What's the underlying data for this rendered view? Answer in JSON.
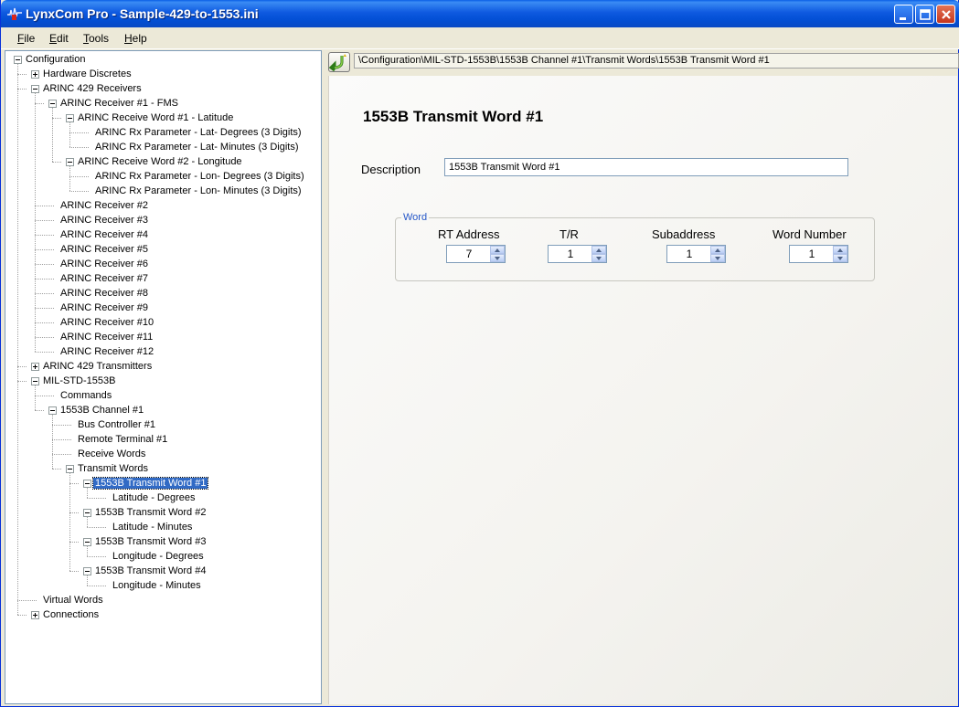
{
  "window": {
    "title": "LynxCom Pro - Sample-429-to-1553.ini",
    "icon": "lynxcom-app-icon"
  },
  "menu": [
    "File",
    "Edit",
    "Tools",
    "Help"
  ],
  "tree": [
    {
      "label": "Configuration",
      "level": 0,
      "exp": "minus"
    },
    {
      "label": "Hardware Discretes",
      "level": 1,
      "exp": "plus"
    },
    {
      "label": "ARINC 429 Receivers",
      "level": 1,
      "exp": "minus"
    },
    {
      "label": "ARINC Receiver #1 - FMS",
      "level": 2,
      "exp": "minus"
    },
    {
      "label": "ARINC Receive Word #1 - Latitude",
      "level": 3,
      "exp": "minus"
    },
    {
      "label": "ARINC Rx Parameter - Lat- Degrees (3 Digits)",
      "level": 4,
      "exp": ""
    },
    {
      "label": "ARINC Rx Parameter - Lat- Minutes (3 Digits)",
      "level": 4,
      "exp": ""
    },
    {
      "label": "ARINC Receive Word #2 - Longitude",
      "level": 3,
      "exp": "minus"
    },
    {
      "label": "ARINC Rx Parameter - Lon- Degrees (3 Digits)",
      "level": 4,
      "exp": ""
    },
    {
      "label": "ARINC Rx Parameter - Lon- Minutes (3 Digits)",
      "level": 4,
      "exp": ""
    },
    {
      "label": "ARINC Receiver #2",
      "level": 2,
      "exp": ""
    },
    {
      "label": "ARINC Receiver #3",
      "level": 2,
      "exp": ""
    },
    {
      "label": "ARINC Receiver #4",
      "level": 2,
      "exp": ""
    },
    {
      "label": "ARINC Receiver #5",
      "level": 2,
      "exp": ""
    },
    {
      "label": "ARINC Receiver #6",
      "level": 2,
      "exp": ""
    },
    {
      "label": "ARINC Receiver #7",
      "level": 2,
      "exp": ""
    },
    {
      "label": "ARINC Receiver #8",
      "level": 2,
      "exp": ""
    },
    {
      "label": "ARINC Receiver #9",
      "level": 2,
      "exp": ""
    },
    {
      "label": "ARINC Receiver #10",
      "level": 2,
      "exp": ""
    },
    {
      "label": "ARINC Receiver #11",
      "level": 2,
      "exp": ""
    },
    {
      "label": "ARINC Receiver #12",
      "level": 2,
      "exp": ""
    },
    {
      "label": "ARINC 429 Transmitters",
      "level": 1,
      "exp": "plus"
    },
    {
      "label": "MIL-STD-1553B",
      "level": 1,
      "exp": "minus"
    },
    {
      "label": "Commands",
      "level": 2,
      "exp": ""
    },
    {
      "label": "1553B Channel #1",
      "level": 2,
      "exp": "minus"
    },
    {
      "label": "Bus Controller #1",
      "level": 3,
      "exp": ""
    },
    {
      "label": "Remote Terminal #1",
      "level": 3,
      "exp": ""
    },
    {
      "label": "Receive Words",
      "level": 3,
      "exp": ""
    },
    {
      "label": "Transmit Words",
      "level": 3,
      "exp": "minus"
    },
    {
      "label": "1553B Transmit Word #1",
      "level": 4,
      "exp": "minus",
      "selected": true
    },
    {
      "label": "Latitude - Degrees",
      "level": 5,
      "exp": ""
    },
    {
      "label": "1553B Transmit Word #2",
      "level": 4,
      "exp": "minus"
    },
    {
      "label": "Latitude - Minutes",
      "level": 5,
      "exp": ""
    },
    {
      "label": "1553B Transmit Word #3",
      "level": 4,
      "exp": "minus"
    },
    {
      "label": "Longitude - Degrees",
      "level": 5,
      "exp": ""
    },
    {
      "label": "1553B Transmit Word #4",
      "level": 4,
      "exp": "minus"
    },
    {
      "label": "Longitude - Minutes",
      "level": 5,
      "exp": ""
    },
    {
      "label": "Virtual Words",
      "level": 1,
      "exp": ""
    },
    {
      "label": "Connections",
      "level": 1,
      "exp": "plus"
    }
  ],
  "pathbar": {
    "back_icon": "back-arrow-icon",
    "path": "\\Configuration\\MIL-STD-1553B\\1553B Channel #1\\Transmit Words\\1553B Transmit Word #1"
  },
  "detail": {
    "title": "1553B Transmit Word #1",
    "description_label": "Description",
    "description_value": "1553B Transmit Word #1",
    "group_label": "Word",
    "fields": [
      {
        "label": "RT Address",
        "value": "7"
      },
      {
        "label": "T/R",
        "value": "1"
      },
      {
        "label": "Subaddress",
        "value": "1"
      },
      {
        "label": "Word Number",
        "value": "1"
      }
    ]
  }
}
